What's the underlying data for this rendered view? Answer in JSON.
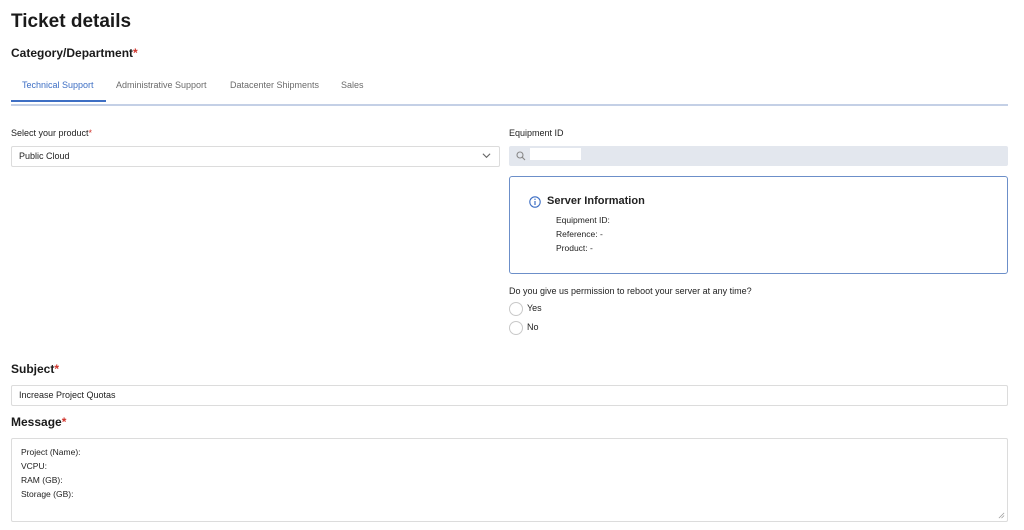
{
  "page": {
    "title": "Ticket details"
  },
  "category": {
    "label": "Category/Department",
    "required": "*",
    "tabs": [
      {
        "label": "Technical Support",
        "active": true
      },
      {
        "label": "Administrative Support",
        "active": false
      },
      {
        "label": "Datacenter Shipments",
        "active": false
      },
      {
        "label": "Sales",
        "active": false
      }
    ]
  },
  "product": {
    "label": "Select your product",
    "required": "*",
    "value": "Public Cloud",
    "icon": "chevron-down-icon"
  },
  "equipment": {
    "label": "Equipment ID",
    "search_value": "",
    "icon": "search-icon"
  },
  "server_info": {
    "title": "Server Information",
    "icon": "info-icon",
    "equipment_id_label": "Equipment ID:",
    "reference_label": "Reference: -",
    "product_label": "Product: -",
    "border_color": "#6c8fc9"
  },
  "reboot": {
    "question": "Do you give us permission to reboot your server at any time?",
    "options": [
      {
        "label": "Yes"
      },
      {
        "label": "No"
      }
    ]
  },
  "subject": {
    "label": "Subject",
    "required": "*",
    "value": "Increase Project Quotas"
  },
  "message": {
    "label": "Message",
    "required": "*",
    "lines": [
      "Project (Name):",
      "VCPU:",
      "RAM (GB):",
      "Storage (GB):"
    ]
  },
  "colors": {
    "accent": "#3e6fc4",
    "required": "#d0342c",
    "search_bg": "#e3e7ee"
  }
}
